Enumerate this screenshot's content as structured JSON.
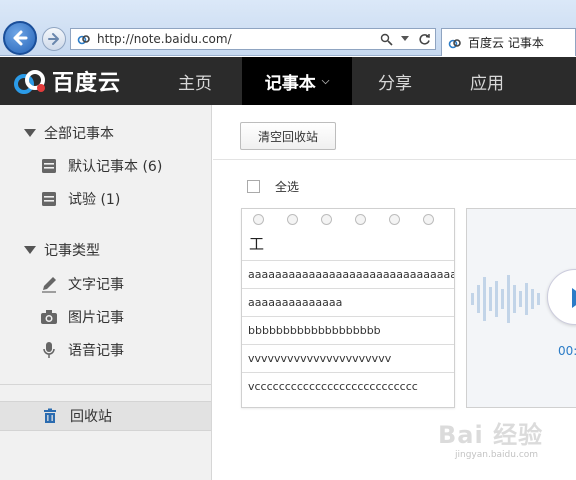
{
  "browser": {
    "url": "http://note.baidu.com/",
    "tab_title": "百度云 记事本",
    "back_icon": "back-arrow-icon",
    "forward_icon": "forward-arrow-icon",
    "search_icon": "search-icon",
    "refresh_icon": "refresh-icon"
  },
  "nav": {
    "logo_text": "百度云",
    "items": [
      {
        "label": "主页"
      },
      {
        "label": "记事本"
      },
      {
        "label": "分享"
      },
      {
        "label": "应用"
      }
    ],
    "active_index": 1
  },
  "sidebar": {
    "group_all": "全部记事本",
    "notebooks": [
      {
        "label": "默认记事本 (6)",
        "icon": "notebook-icon"
      },
      {
        "label": "试验 (1)",
        "icon": "notebook-icon"
      }
    ],
    "group_types": "记事类型",
    "types": [
      {
        "label": "文字记事",
        "icon": "pencil-icon"
      },
      {
        "label": "图片记事",
        "icon": "camera-icon"
      },
      {
        "label": "语音记事",
        "icon": "microphone-icon"
      }
    ],
    "recycle": {
      "label": "回收站",
      "icon": "trash-icon"
    }
  },
  "main": {
    "clear_button": "清空回收站",
    "select_all": "全选",
    "note_card": {
      "title": "工",
      "lines": [
        "aaaaaaaaaaaaaaaaaaaaaaaaaaaaaaa",
        "aaaaaaaaaaaaaa",
        "bbbbbbbbbbbbbbbbbbb",
        "vvvvvvvvvvvvvvvvvvvvvv",
        "vccccccccccccccccccccccccccc"
      ]
    },
    "voice_card": {
      "duration": "00:"
    }
  },
  "watermark": {
    "text": "Bai 经验",
    "sub": "jingyan.baidu.com"
  },
  "colors": {
    "nav_bg": "#2b2b2b",
    "nav_active": "#000000",
    "accent_blue": "#2b7cc7",
    "sidebar_bg": "#f1f1f1"
  }
}
